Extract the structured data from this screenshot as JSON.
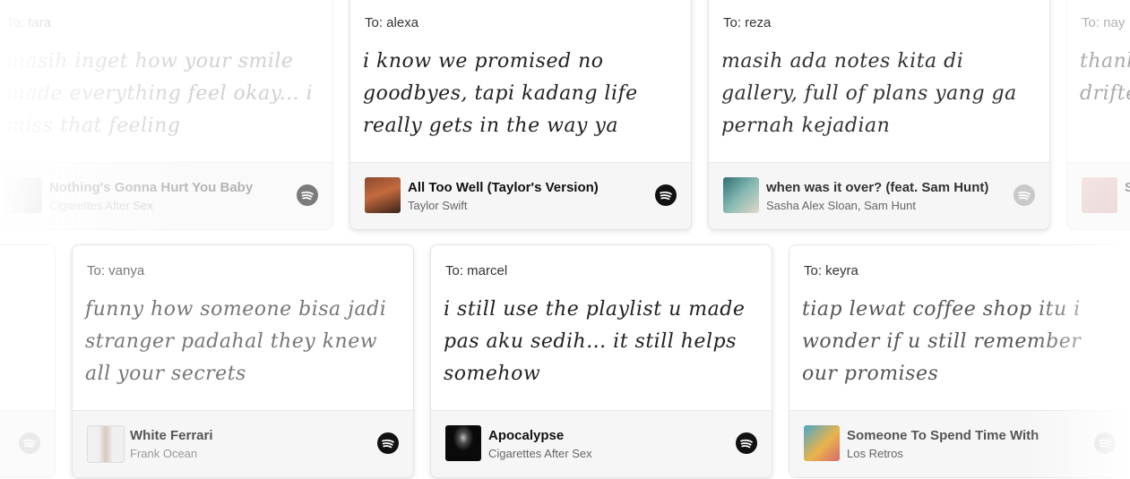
{
  "cards": [
    {
      "to": "To: tara",
      "message": "masih inget how your smile made everything feel okay... i miss that feeling",
      "song": "Nothing's Gonna Hurt You Baby",
      "artist": "Cigarettes After Sex"
    },
    {
      "to": "To: alexa",
      "message": "i know we promised no goodbyes, tapi kadang life really gets in the way ya",
      "song": "All Too Well (Taylor's Version)",
      "artist": "Taylor Swift"
    },
    {
      "to": "To: reza",
      "message": "masih ada notes kita di gallery, full of plans yang ga pernah kejadian",
      "song": "when was it over? (feat. Sam Hunt)",
      "artist": "Sasha Alex Sloan, Sam Hunt"
    },
    {
      "to": "To: nay",
      "message": "thank you for the place... drifted",
      "song": "S",
      "artist": ""
    },
    {
      "to": "",
      "message": "",
      "song": "",
      "artist": ""
    },
    {
      "to": "To: vanya",
      "message": "funny how someone bisa jadi stranger padahal they knew all your secrets",
      "song": "White Ferrari",
      "artist": "Frank Ocean"
    },
    {
      "to": "To: marcel",
      "message": "i still use the playlist u made pas aku sedih... it still helps somehow",
      "song": "Apocalypse",
      "artist": "Cigarettes After Sex"
    },
    {
      "to": "To: keyra",
      "message": "tiap lewat coffee shop itu i wonder if u still remember our promises",
      "song": "Someone To Spend Time With",
      "artist": "Los Retros"
    }
  ],
  "icons": {
    "music_service": "spotify-icon"
  }
}
